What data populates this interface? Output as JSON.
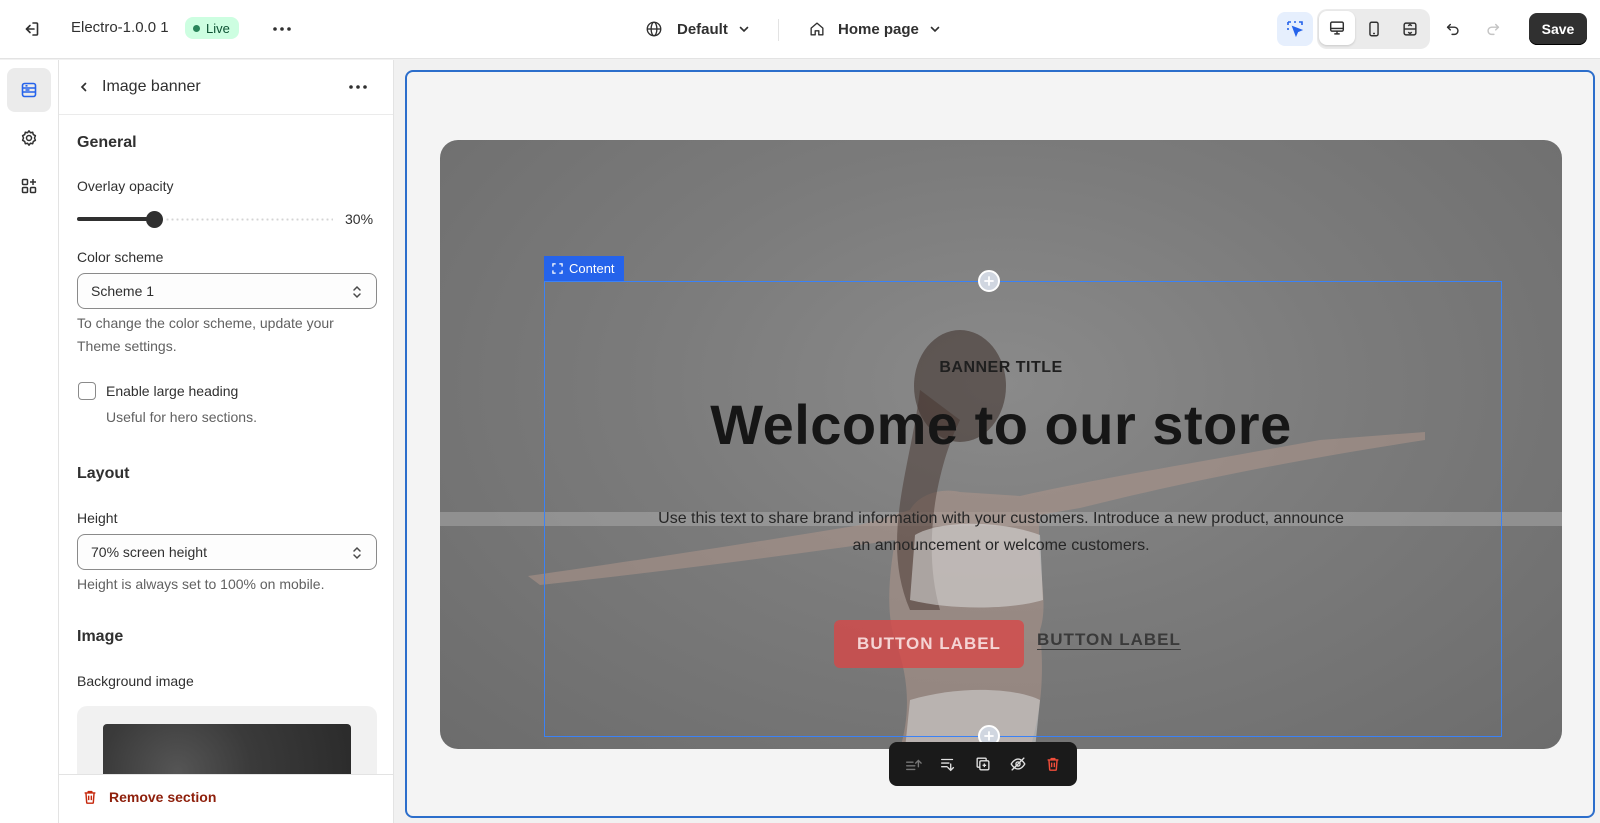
{
  "topbar": {
    "theme_name": "Electro-1.0.0 1",
    "status_badge": "Live",
    "context_label": "Default",
    "page_selector": "Home page",
    "save_label": "Save"
  },
  "panel": {
    "title": "Image banner",
    "general_heading": "General",
    "overlay_label": "Overlay opacity",
    "overlay_value_text": "30%",
    "overlay_fraction": 0.3,
    "color_scheme_label": "Color scheme",
    "color_scheme_value": "Scheme 1",
    "color_scheme_help": "To change the color scheme, update your Theme settings.",
    "large_heading_label": "Enable large heading",
    "large_heading_help": "Useful for hero sections.",
    "large_heading_checked": false,
    "layout_heading": "Layout",
    "height_label": "Height",
    "height_value": "70% screen height",
    "height_help": "Height is always set to 100% on mobile.",
    "image_heading": "Image",
    "bg_image_label": "Background image",
    "remove_label": "Remove section"
  },
  "preview": {
    "content_tag": "Content",
    "eyebrow": "BANNER TITLE",
    "heading": "Welcome to our store",
    "text": "Use this text to share brand information with your customers. Introduce a new product, announce an announcement or welcome customers.",
    "button_primary": "BUTTON LABEL",
    "button_secondary": "BUTTON LABEL"
  },
  "colors": {
    "accent": "#2563eb",
    "live_bg": "#cdfee1",
    "save_bg": "#303030",
    "danger": "#8e1f0b"
  }
}
